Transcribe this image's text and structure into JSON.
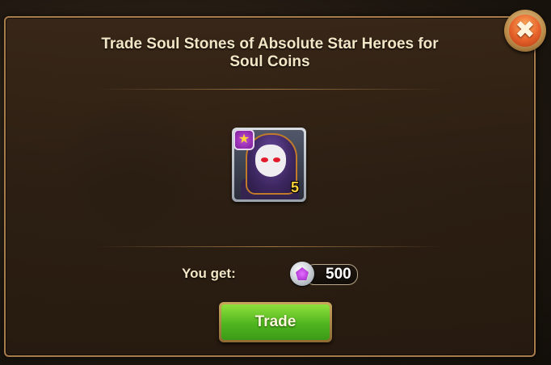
{
  "dialog": {
    "title": "Trade Soul Stones of Absolute Star Heroes for Soul Coins",
    "hero_card": {
      "icon": "absolute-star-hero-portrait",
      "star_icon": "★",
      "count": "5"
    },
    "reward": {
      "label": "You get:",
      "coin_icon": "soul-coin-icon",
      "amount": "500"
    },
    "trade_button_label": "Trade",
    "close_icon": "✖"
  },
  "colors": {
    "frame_border": "#a97c4c",
    "title_text": "#f3e6c6",
    "trade_green": "#4fb520",
    "count_yellow": "#ffd23a",
    "close_orange": "#e5602a"
  }
}
